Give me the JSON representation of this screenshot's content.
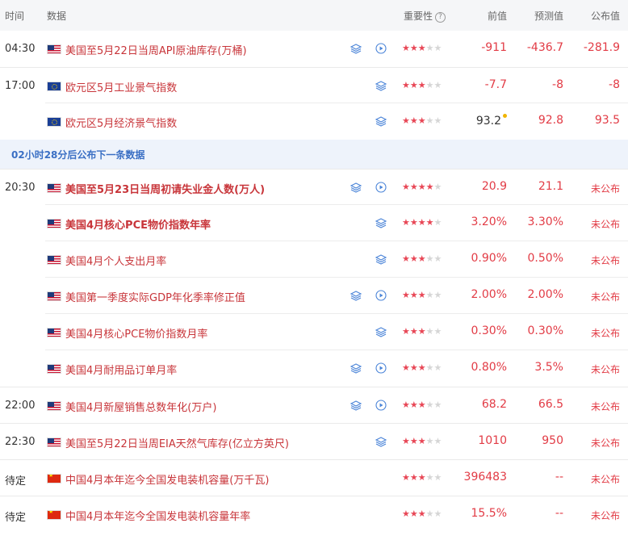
{
  "header": {
    "time": "时间",
    "data": "数据",
    "importance": "重要性",
    "help": "?",
    "previous": "前值",
    "forecast": "预测值",
    "actual": "公布值"
  },
  "banner_text": "02小时28分后公布下一条数据",
  "colors": {
    "accent_red": "#e23b45",
    "name_red": "#c8353a",
    "banner_blue": "#3a6fc4",
    "star_on": "#e84756",
    "star_off": "#d6d6d6"
  },
  "rows": [
    {
      "time": "04:30",
      "flag": "us",
      "name": "美国至5月22日当周API原油库存(万桶)",
      "bold": false,
      "icons": [
        "layers-icon",
        "play-icon"
      ],
      "stars": 3,
      "previous": "-911",
      "forecast": "-436.7",
      "actual": "-281.9",
      "prev_color": "red",
      "fore_color": "red",
      "act_color": "red"
    },
    {
      "time": "17:00",
      "flag": "eu",
      "name": "欧元区5月工业景气指数",
      "bold": false,
      "icons": [
        "layers-icon"
      ],
      "stars": 3,
      "previous": "-7.7",
      "forecast": "-8",
      "actual": "-8",
      "prev_color": "red",
      "fore_color": "red",
      "act_color": "red"
    },
    {
      "time": "",
      "flag": "eu",
      "name": "欧元区5月经济景气指数",
      "bold": false,
      "icons": [
        "layers-icon"
      ],
      "stars": 3,
      "previous": "93.2",
      "previous_revised": true,
      "forecast": "92.8",
      "actual": "93.5",
      "prev_color": "dark",
      "fore_color": "red",
      "act_color": "red"
    },
    {
      "banner": true
    },
    {
      "time": "20:30",
      "flag": "us",
      "name": "美国至5月23日当周初请失业金人数(万人)",
      "bold": true,
      "icons": [
        "layers-icon",
        "play-icon"
      ],
      "stars": 4,
      "previous": "20.9",
      "forecast": "21.1",
      "actual": "未公布",
      "prev_color": "red",
      "fore_color": "red",
      "act_color": "pending"
    },
    {
      "time": "",
      "flag": "us",
      "name": "美国4月核心PCE物价指数年率",
      "bold": true,
      "icons": [
        "layers-icon"
      ],
      "stars": 4,
      "previous": "3.20%",
      "forecast": "3.30%",
      "actual": "未公布",
      "prev_color": "red",
      "fore_color": "red",
      "act_color": "pending"
    },
    {
      "time": "",
      "flag": "us",
      "name": "美国4月个人支出月率",
      "bold": false,
      "icons": [
        "layers-icon"
      ],
      "stars": 3,
      "previous": "0.90%",
      "forecast": "0.50%",
      "actual": "未公布",
      "prev_color": "red",
      "fore_color": "red",
      "act_color": "pending"
    },
    {
      "time": "",
      "flag": "us",
      "name": "美国第一季度实际GDP年化季率修正值",
      "bold": false,
      "icons": [
        "layers-icon",
        "play-icon"
      ],
      "stars": 3,
      "previous": "2.00%",
      "forecast": "2.00%",
      "actual": "未公布",
      "prev_color": "red",
      "fore_color": "red",
      "act_color": "pending"
    },
    {
      "time": "",
      "flag": "us",
      "name": "美国4月核心PCE物价指数月率",
      "bold": false,
      "icons": [
        "layers-icon"
      ],
      "stars": 3,
      "previous": "0.30%",
      "forecast": "0.30%",
      "actual": "未公布",
      "prev_color": "red",
      "fore_color": "red",
      "act_color": "pending"
    },
    {
      "time": "",
      "flag": "us",
      "name": "美国4月耐用品订单月率",
      "bold": false,
      "icons": [
        "layers-icon",
        "play-icon"
      ],
      "stars": 3,
      "previous": "0.80%",
      "forecast": "3.5%",
      "actual": "未公布",
      "prev_color": "red",
      "fore_color": "red",
      "act_color": "pending"
    },
    {
      "time": "22:00",
      "flag": "us",
      "name": "美国4月新屋销售总数年化(万户)",
      "bold": false,
      "icons": [
        "layers-icon",
        "play-icon"
      ],
      "stars": 3,
      "previous": "68.2",
      "forecast": "66.5",
      "actual": "未公布",
      "prev_color": "red",
      "fore_color": "red",
      "act_color": "pending"
    },
    {
      "time": "22:30",
      "flag": "us",
      "name": "美国至5月22日当周EIA天然气库存(亿立方英尺)",
      "bold": false,
      "icons": [
        "layers-icon"
      ],
      "stars": 3,
      "previous": "1010",
      "forecast": "950",
      "actual": "未公布",
      "prev_color": "red",
      "fore_color": "red",
      "act_color": "pending"
    },
    {
      "time": "待定",
      "flag": "cn",
      "name": "中国4月本年迄今全国发电装机容量(万千瓦)",
      "bold": false,
      "icons": [],
      "stars": 3,
      "previous": "396483",
      "forecast": "--",
      "actual": "未公布",
      "prev_color": "red",
      "fore_color": "red",
      "act_color": "pending"
    },
    {
      "time": "待定",
      "flag": "cn",
      "name": "中国4月本年迄今全国发电装机容量年率",
      "bold": false,
      "icons": [],
      "stars": 3,
      "previous": "15.5%",
      "forecast": "--",
      "actual": "未公布",
      "prev_color": "red",
      "fore_color": "red",
      "act_color": "pending"
    }
  ]
}
